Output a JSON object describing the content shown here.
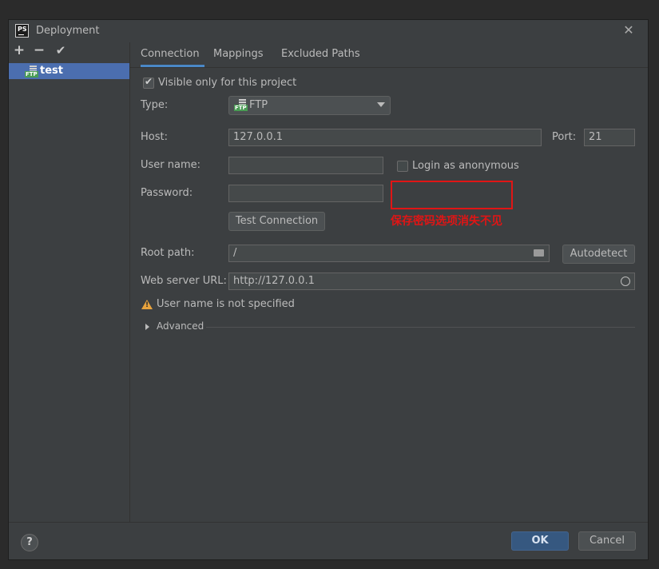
{
  "window": {
    "title": "Deployment",
    "app_icon_text": "PS",
    "close_glyph": "✕"
  },
  "toolbar": {
    "add": "+",
    "remove": "−",
    "default": "✔"
  },
  "servers": [
    {
      "name": "test",
      "icon": "ftp-server-icon",
      "icon_label": "FTP"
    }
  ],
  "tabs": [
    {
      "label": "Connection",
      "active": true
    },
    {
      "label": "Mappings",
      "active": false
    },
    {
      "label": "Excluded Paths",
      "active": false
    }
  ],
  "connection": {
    "visible_only": {
      "label": "Visible only for this project",
      "checked": true
    },
    "type": {
      "label": "Type:",
      "value": "FTP",
      "icon_label": "FTP"
    },
    "host": {
      "label": "Host:",
      "value": "127.0.0.1"
    },
    "port": {
      "label": "Port:",
      "value": "21"
    },
    "username": {
      "label": "User name:",
      "value": ""
    },
    "anonymous": {
      "label": "Login as anonymous",
      "checked": false
    },
    "password": {
      "label": "Password:",
      "value": ""
    },
    "test_connection": "Test Connection",
    "root_path": {
      "label": "Root path:",
      "value": "/"
    },
    "autodetect": "Autodetect",
    "web_url": {
      "label": "Web server URL:",
      "value": "http://127.0.0.1"
    },
    "warning": "User name is not specified",
    "advanced": "Advanced"
  },
  "annotation": {
    "note": "保存密码选项消失不见",
    "color": "#e01515"
  },
  "footer": {
    "help": "?",
    "ok": "OK",
    "cancel": "Cancel"
  },
  "colors": {
    "accent": "#4a88c7",
    "selection": "#4b6eaf",
    "ok_button": "#365880",
    "warning": "#e8a33d"
  }
}
